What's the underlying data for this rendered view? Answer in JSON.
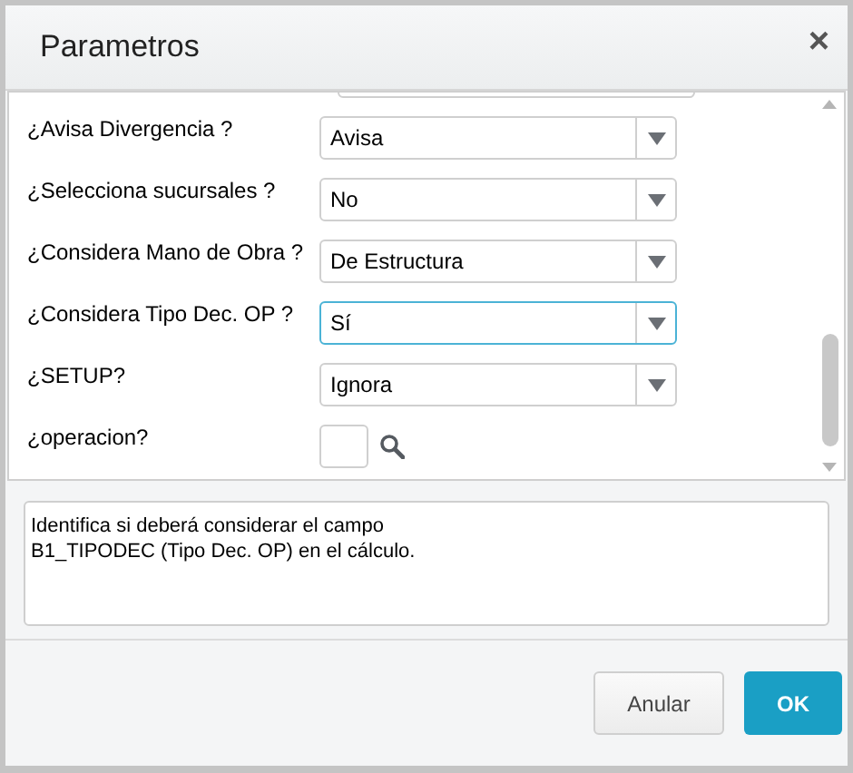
{
  "window": {
    "title": "Parametros",
    "close": "×"
  },
  "parameters": [
    {
      "label": "¿Avisa Divergencia ?",
      "kind": "select",
      "value": "Avisa",
      "focused": false
    },
    {
      "label": "¿Selecciona sucursales ?",
      "kind": "select",
      "value": "No",
      "focused": false
    },
    {
      "label": "¿Considera Mano de Obra ?",
      "kind": "select",
      "value": "De Estructura",
      "focused": false
    },
    {
      "label": "¿Considera Tipo Dec. OP ?",
      "kind": "select",
      "value": "Sí",
      "focused": true
    },
    {
      "label": "¿SETUP?",
      "kind": "select",
      "value": "Ignora",
      "focused": false
    },
    {
      "label": "¿operacion?",
      "kind": "lookup",
      "focused": false
    }
  ],
  "description": "Identifica si deberá considerar el campo\nB1_TIPODEC (Tipo Dec. OP) en el cálculo.",
  "buttons": [
    {
      "label": "Anular",
      "kind": "secondary"
    },
    {
      "label": "OK",
      "kind": "primary"
    }
  ]
}
